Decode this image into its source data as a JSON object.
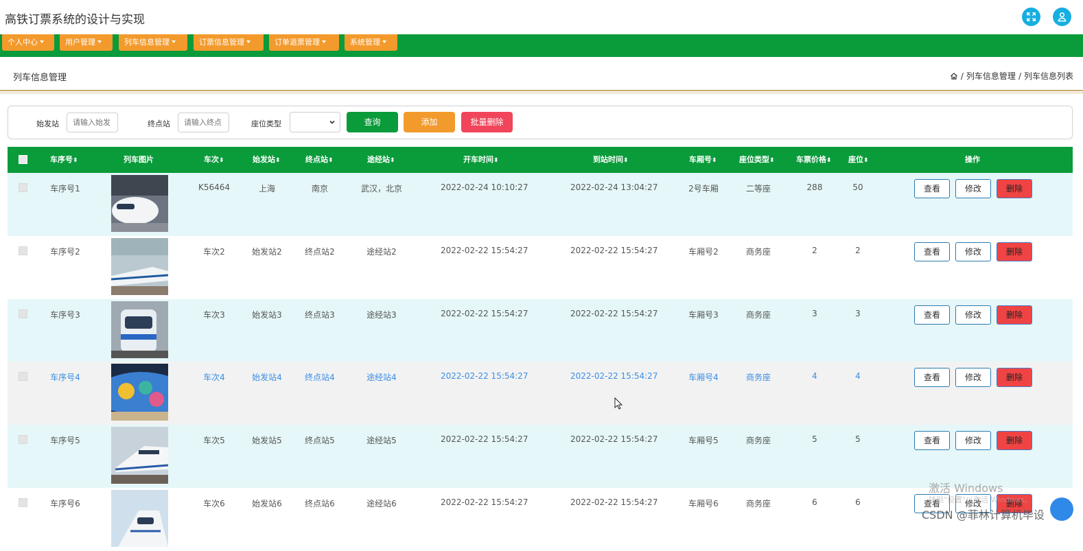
{
  "app": {
    "title": "高铁订票系统的设计与实现"
  },
  "nav": {
    "items": [
      {
        "label": "个人中心"
      },
      {
        "label": "用户管理"
      },
      {
        "label": "列车信息管理"
      },
      {
        "label": "订票信息管理"
      },
      {
        "label": "订单退票管理"
      },
      {
        "label": "系统管理"
      }
    ]
  },
  "page": {
    "title": "列车信息管理",
    "breadcrumb": [
      "列车信息管理",
      "列车信息列表"
    ],
    "breadcrumb_sep": "/"
  },
  "filter": {
    "start_label": "始发站",
    "start_placeholder": "请输入始发",
    "end_label": "终点站",
    "end_placeholder": "请输入终点",
    "seat_label": "座位类型",
    "seat_value": "",
    "query_label": "查询",
    "add_label": "添加",
    "batch_delete_label": "批量删除"
  },
  "table": {
    "columns": [
      "车序号",
      "列车图片",
      "车次",
      "始发站",
      "终点站",
      "途经站",
      "开车时间",
      "到站时间",
      "车厢号",
      "座位类型",
      "车票价格",
      "座位",
      "操作"
    ],
    "sort_glyph": "⬍",
    "actions": {
      "view": "查看",
      "edit": "修改",
      "delete": "删除"
    },
    "rows": [
      {
        "no": "车序号1",
        "train": "K56464",
        "start": "上海",
        "end": "南京",
        "via": "武汉，北京",
        "depart": "2022-02-24 10:10:27",
        "arrive": "2022-02-24 13:04:27",
        "carriage": "2号车厢",
        "seat_type": "二等座",
        "price": "288",
        "seat": "50"
      },
      {
        "no": "车序号2",
        "train": "车次2",
        "start": "始发站2",
        "end": "终点站2",
        "via": "途经站2",
        "depart": "2022-02-22 15:54:27",
        "arrive": "2022-02-22 15:54:27",
        "carriage": "车厢号2",
        "seat_type": "商务座",
        "price": "2",
        "seat": "2"
      },
      {
        "no": "车序号3",
        "train": "车次3",
        "start": "始发站3",
        "end": "终点站3",
        "via": "途经站3",
        "depart": "2022-02-22 15:54:27",
        "arrive": "2022-02-22 15:54:27",
        "carriage": "车厢号3",
        "seat_type": "商务座",
        "price": "3",
        "seat": "3"
      },
      {
        "no": "车序号4",
        "train": "车次4",
        "start": "始发站4",
        "end": "终点站4",
        "via": "途经站4",
        "depart": "2022-02-22 15:54:27",
        "arrive": "2022-02-22 15:54:27",
        "carriage": "车厢号4",
        "seat_type": "商务座",
        "price": "4",
        "seat": "4"
      },
      {
        "no": "车序号5",
        "train": "车次5",
        "start": "始发站5",
        "end": "终点站5",
        "via": "途经站5",
        "depart": "2022-02-22 15:54:27",
        "arrive": "2022-02-22 15:54:27",
        "carriage": "车厢号5",
        "seat_type": "商务座",
        "price": "5",
        "seat": "5"
      },
      {
        "no": "车序号6",
        "train": "车次6",
        "start": "始发站6",
        "end": "终点站6",
        "via": "途经站6",
        "depart": "2022-02-22 15:54:27",
        "arrive": "2022-02-22 15:54:27",
        "carriage": "车厢号6",
        "seat_type": "商务座",
        "price": "6",
        "seat": "6"
      }
    ]
  },
  "overlay": {
    "activate_title": "激活 Windows",
    "activate_sub": "转到\"设置\"以激活 Windows。",
    "csdn": "CSDN @菲林计算机毕设"
  },
  "colors": {
    "nav_green": "#0a9b3a",
    "nav_orange": "#f39a2c",
    "row_tint": "#e5f7f8",
    "row_hover": "#f2f2f2",
    "delete_red": "#f04444",
    "accent_blue": "#17aee0"
  },
  "icons": [
    "fullscreen-icon",
    "user-icon",
    "home-icon",
    "chevron-down-icon",
    "cursor-icon"
  ]
}
